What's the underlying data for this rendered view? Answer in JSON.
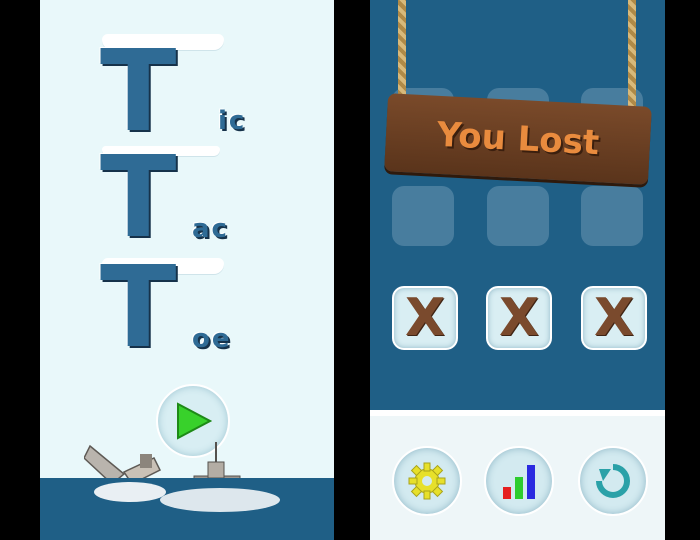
{
  "menu": {
    "title_words": [
      {
        "big": "T",
        "small": "ic"
      },
      {
        "big": "T",
        "small": "ac"
      },
      {
        "big": "T",
        "small": "oe"
      }
    ],
    "play_icon": "play-icon"
  },
  "game": {
    "result_label": "You Lost",
    "board_revealed_row": [
      "X",
      "X",
      "X"
    ],
    "buttons": {
      "settings_icon": "gear-icon",
      "stats_icon": "bar-chart-icon",
      "restart_icon": "restart-icon"
    }
  },
  "colors": {
    "ice_bg": "#e9f8fa",
    "sea": "#1f5f86",
    "letter": "#2f6b95",
    "play_green": "#38d12b",
    "sign_text": "#e98b3e",
    "wood_x": "#7a4a2d"
  }
}
